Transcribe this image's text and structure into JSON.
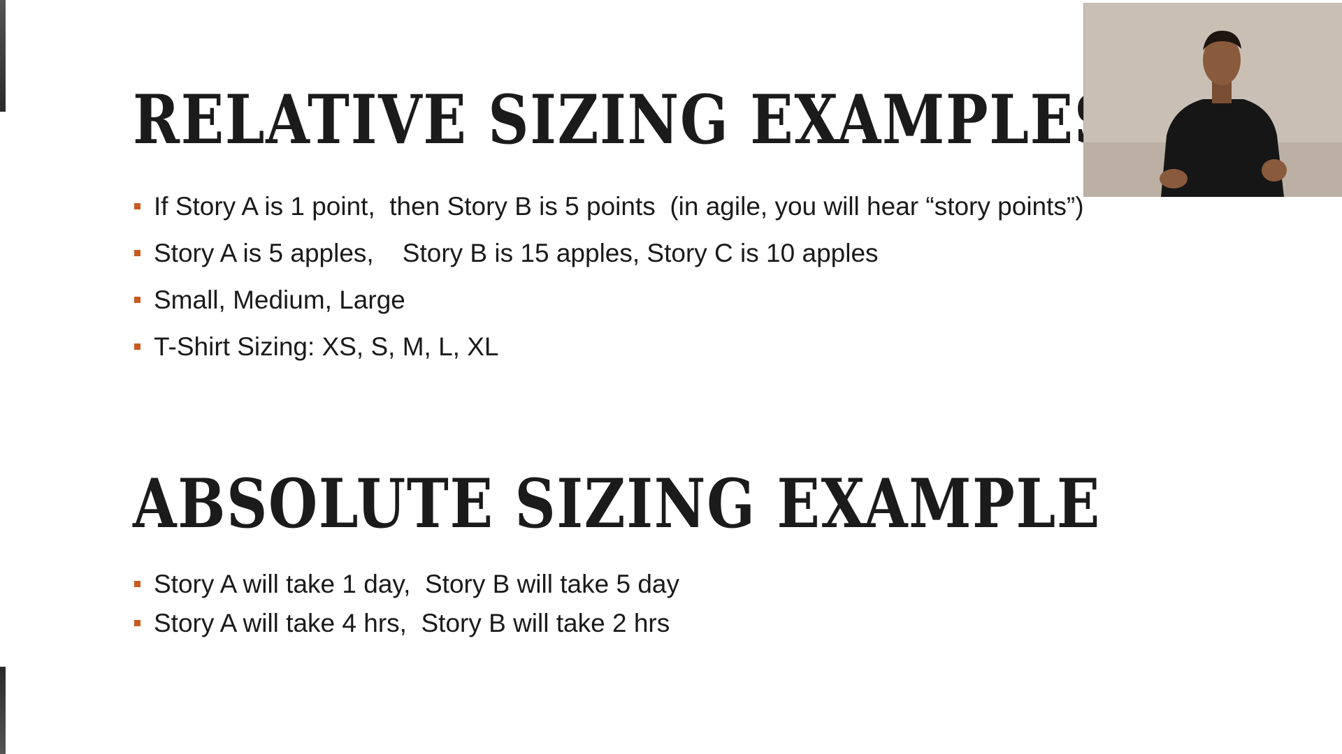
{
  "slide": {
    "relative_heading": "RELATIVE SIZING EXAMPLES",
    "relative_bullets": [
      "If Story A is 1 point,  then Story B is 5 points  (in agile, you will hear “story points”)",
      "Story A is 5 apples,    Story B is 15 apples, Story C is 10 apples",
      "Small, Medium, Large",
      "T-Shirt Sizing: XS, S, M, L, XL"
    ],
    "absolute_heading": "ABSOLUTE SIZING EXAMPLE",
    "absolute_bullets": [
      "Story A will take 1 day,  Story B will take 5 day",
      "Story A will take 4 hrs,  Story B will take 2 hrs"
    ]
  },
  "colors": {
    "bullet_accent": "#c85a1e",
    "heading_text": "#1b1b1b",
    "body_text": "#1a1a1a"
  },
  "webcam": {
    "icon": "presenter-video"
  }
}
